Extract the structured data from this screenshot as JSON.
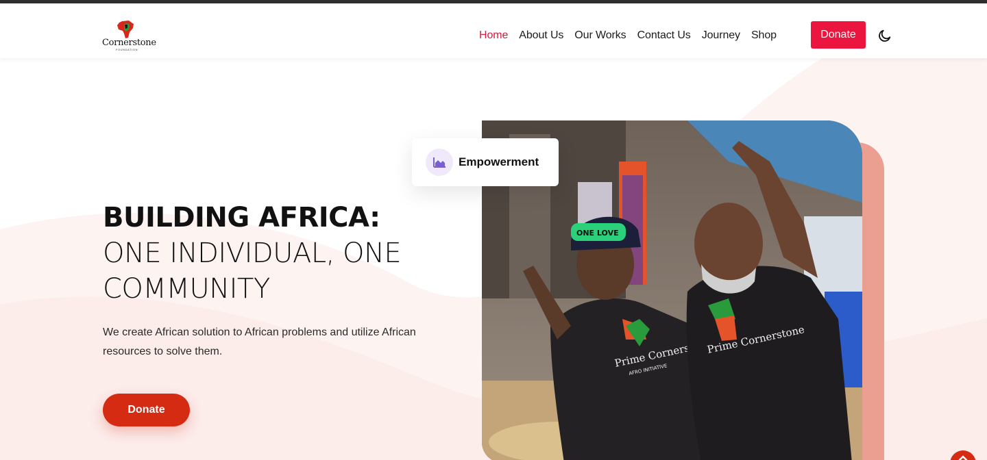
{
  "brand": {
    "name": "Cornerstone",
    "tagline": "FOUNDATION",
    "logo_icon": "africa-fist-icon"
  },
  "nav": {
    "items": [
      {
        "label": "Home",
        "active": true
      },
      {
        "label": "About Us",
        "active": false
      },
      {
        "label": "Our Works",
        "active": false
      },
      {
        "label": "Contact Us",
        "active": false
      },
      {
        "label": "Journey",
        "active": false
      },
      {
        "label": "Shop",
        "active": false
      }
    ],
    "donate_label": "Donate",
    "theme_toggle_icon": "moon-icon"
  },
  "hero": {
    "title_bold": "BUILDING AFRICA:",
    "title_light": "ONE INDIVIDUAL, ONE COMMUNITY",
    "description": "We create African solution to African problems and utilize African resources to solve them.",
    "donate_label": "Donate"
  },
  "badge": {
    "label": "Empowerment",
    "icon": "area-chart-icon"
  },
  "photo": {
    "shirt_text": "Prime Cornerstone",
    "shirt_subtext": "AFRO INITIATIVE",
    "cap_text": "ONE LOVE"
  },
  "scroll_top_icon": "chevron-up-icon",
  "colors": {
    "accent": "#ea1640",
    "active_link": "#d81b3c",
    "hero_button": "#d52b12",
    "photo_back": "#eb9f90",
    "badge_icon_bg": "#efe9fb",
    "badge_icon": "#7b5fd1"
  }
}
